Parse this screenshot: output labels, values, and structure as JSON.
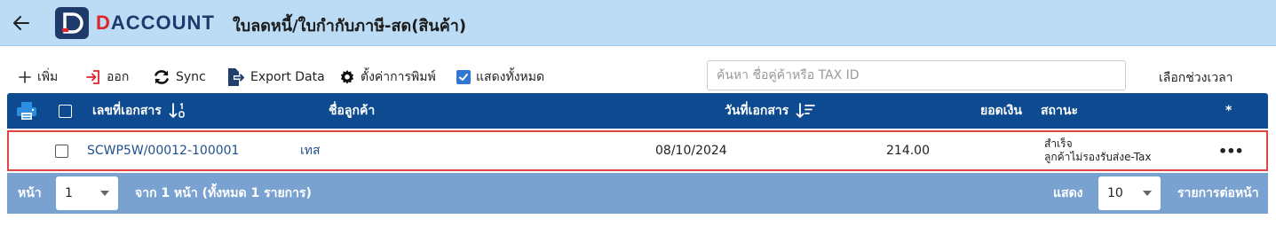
{
  "header": {
    "brand_mark": "D",
    "brand_rest": "ACCOUNT",
    "title": "ใบลดหนี้/ใบกำกับภาษี-สด(สินค้า)"
  },
  "toolbar": {
    "add_label": "เพิ่ม",
    "exit_label": "ออก",
    "sync_label": "Sync",
    "export_label": "Export Data",
    "print_settings_label": "ตั้งค่าการพิมพ์",
    "show_all_label": "แสดงทั้งหมด",
    "show_all_checked": true,
    "search_placeholder": "ค้นหา ชื่อคู่ค้าหรือ TAX ID",
    "period_label": "เลือกช่วงเวลา"
  },
  "table": {
    "columns": {
      "doc_no": "เลขที่เอกสาร",
      "customer": "ชื่อลูกค้า",
      "doc_date": "วันที่เอกสาร",
      "amount": "ยอดเงิน",
      "status": "สถานะ",
      "star": "*"
    },
    "rows": [
      {
        "doc_no": "SCWP5W/00012-100001",
        "customer": "เทส",
        "doc_date": "08/10/2024",
        "amount": "214.00",
        "status_line1": "สำเร็จ",
        "status_line2": "ลูกค้าไม่รองรับส่งe-Tax",
        "more": "•••"
      }
    ]
  },
  "pagination": {
    "page_label": "หน้า",
    "page_value": "1",
    "of_text": "จาก 1 หน้า (ทั้งหมด 1 รายการ)",
    "show_label": "แสดง",
    "per_page_value": "10",
    "per_page_suffix": "รายการต่อหน้า"
  },
  "colors": {
    "header_bg": "#bcdcf5",
    "table_header": "#0e4a8f",
    "footer_bg": "#7aa2d0",
    "accent_red": "#e0222a",
    "highlight_border": "#e04545"
  }
}
